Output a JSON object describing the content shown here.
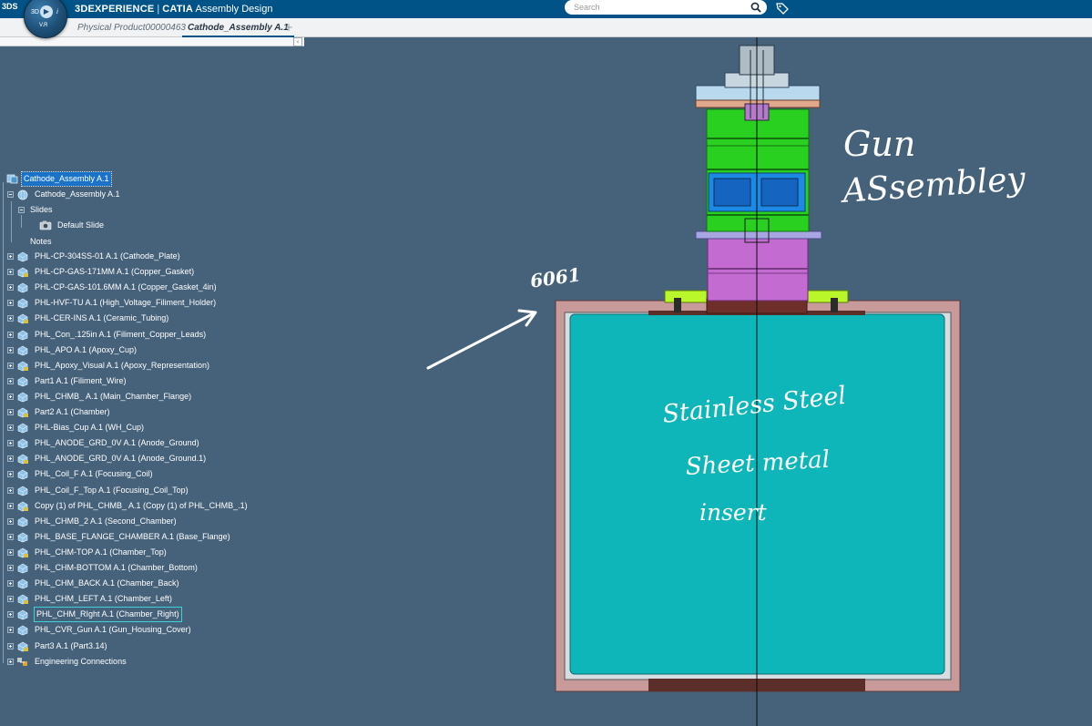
{
  "header": {
    "logo": "3DS",
    "brand": "3DEXPERIENCE",
    "app": "CATIA",
    "app_role": "Assembly Design",
    "compass_label": "3D",
    "compass_version": "V.R",
    "search_placeholder": "Search"
  },
  "tabs": [
    {
      "label": "Physical Product00000463",
      "active": false
    },
    {
      "label": "Cathode_Assembly A.1",
      "active": true
    }
  ],
  "tree": {
    "root": "Cathode_Assembly A.1",
    "child": "Cathode_Assembly A.1",
    "slides": "Slides",
    "default_slide": "Default Slide",
    "notes": "Notes",
    "parts": [
      "PHL-CP-304SS-01 A.1 (Cathode_Plate)",
      "PHL-CP-GAS-171MM A.1 (Copper_Gasket)",
      "PHL-CP-GAS-101.6MM A.1 (Copper_Gasket_4in)",
      "PHL-HVF-TU A.1 (High_Voltage_Filiment_Holder)",
      "PHL-CER-INS A.1 (Ceramic_Tubing)",
      "PHL_Con_.125in A.1 (Filiment_Copper_Leads)",
      "PHL_APO A.1 (Apoxy_Cup)",
      "PHL_Apoxy_Visual A.1 (Apoxy_Representation)",
      "Part1 A.1 (Filiment_Wire)",
      "PHL_CHMB_ A.1 (Main_Chamber_Flange)",
      "Part2 A.1 (Chamber)",
      "PHL-Bias_Cup A.1 (WH_Cup)",
      "PHL_ANODE_GRD_0V A.1 (Anode_Ground)",
      "PHL_ANODE_GRD_0V A.1 (Anode_Ground.1)",
      "PHL_Coil_F A.1 (Focusing_Coil)",
      "PHL_Coil_F_Top A.1 (Focusing_Coil_Top)",
      "Copy (1) of PHL_CHMB_ A.1 (Copy (1) of PHL_CHMB_.1)",
      "PHL_CHMB_2 A.1 (Second_Chamber)",
      "PHL_BASE_FLANGE_CHAMBER A.1 (Base_Flange)",
      "PHL_CHM-TOP A.1 (Chamber_Top)",
      "PHL_CHM-BOTTOM A.1 (Chamber_Bottom)",
      "PHL_CHM_BACK A.1 (Chamber_Back)",
      "PHL_CHM_LEFT A.1 (Chamber_Left)",
      "PHL_CHM_RIght A.1 (Chamber_Right)",
      "PHL_CVR_Gun A.1 (Gun_Housing_Cover)",
      "Part3 A.1 (Part3.14)",
      "Engineering Connections"
    ],
    "highlighted_index": 23
  },
  "annotations": {
    "gun_line1": "Gun",
    "gun_line2": "ASsembley",
    "material": "6061",
    "ss_line1": "Stainless Steel",
    "ss_line2": "Sheet metal",
    "ss_line3": "insert"
  },
  "colors": {
    "topbar": "#005386",
    "background": "#46627a",
    "chamber_fill": "#0fb6b9",
    "chamber_frame": "#c99a9a",
    "gun_green": "#2ad01f",
    "gun_magenta": "#c36bd0",
    "flange_lime": "#b9f72b",
    "selection": "#1a73c9"
  }
}
